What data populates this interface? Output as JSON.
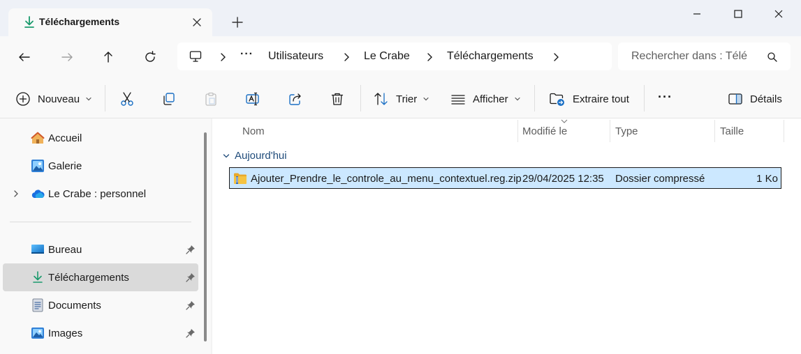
{
  "tab": {
    "title": "Téléchargements"
  },
  "breadcrumb": [
    "Utilisateurs",
    "Le Crabe",
    "Téléchargements"
  ],
  "breadcrumb_overflow": "···",
  "search": {
    "placeholder": "Rechercher dans : Télé"
  },
  "commands": {
    "new": "Nouveau",
    "sort": "Trier",
    "view": "Afficher",
    "extract": "Extraire tout",
    "more": "···",
    "details": "Détails"
  },
  "sidebar": {
    "items": [
      {
        "label": "Accueil",
        "icon": "home-icon"
      },
      {
        "label": "Galerie",
        "icon": "gallery-icon"
      },
      {
        "label": "Le Crabe : personnel",
        "icon": "onedrive-icon"
      },
      {
        "label": "Bureau",
        "icon": "desktop-icon"
      },
      {
        "label": "Téléchargements",
        "icon": "download-icon"
      },
      {
        "label": "Documents",
        "icon": "documents-icon"
      },
      {
        "label": "Images",
        "icon": "images-icon"
      }
    ]
  },
  "columns": {
    "name": "Nom",
    "modified": "Modifié le",
    "type": "Type",
    "size": "Taille"
  },
  "group": {
    "label": "Aujourd'hui"
  },
  "files": [
    {
      "name": "Ajouter_Prendre_le_controle_au_menu_contextuel.reg.zip",
      "modified": "29/04/2025 12:35",
      "type": "Dossier compressé",
      "size": "1 Ko"
    }
  ],
  "colors": {
    "accent": "#1a9a6c",
    "selection": "#cce8ff",
    "folder": "#f5c342"
  }
}
